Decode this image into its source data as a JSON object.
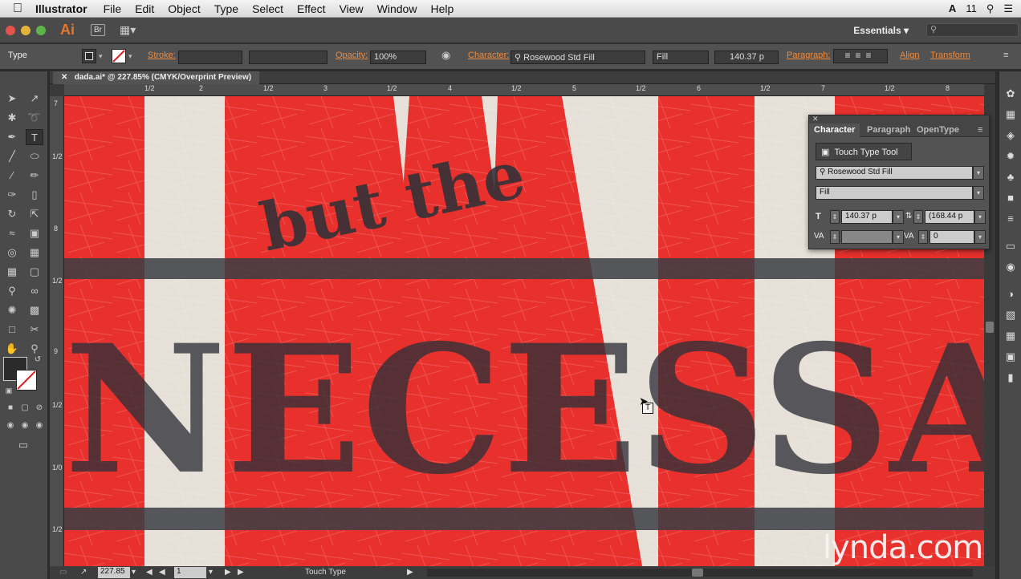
{
  "menubar": {
    "app_name": "Illustrator",
    "items": [
      "File",
      "Edit",
      "Object",
      "Type",
      "Select",
      "Effect",
      "View",
      "Window",
      "Help"
    ],
    "status_num": "11"
  },
  "appbar": {
    "app_logo": "Ai",
    "bridge_label": "Br",
    "workspace": "Essentials"
  },
  "control_bar": {
    "tool_label": "Type",
    "stroke_label": "Stroke:",
    "opacity_label": "Opacity:",
    "opacity_value": "100%",
    "character_label": "Character:",
    "font_family": "Rosewood Std Fill",
    "font_style": "Fill",
    "font_size": "140.37 p",
    "paragraph_label": "Paragraph:",
    "align_label": "Align",
    "transform_label": "Transform"
  },
  "document": {
    "tab_title": "dada.ai* @ 227.85% (CMYK/Overprint Preview)",
    "ruler_top": [
      "1/2",
      "2",
      "1/2",
      "3",
      "1/2",
      "4",
      "1/2",
      "5",
      "1/2",
      "6",
      "1/2",
      "7",
      "1/2",
      "8"
    ],
    "ruler_left": [
      "7",
      "1/2",
      "8",
      "1/2",
      "9",
      "1/2",
      "1/0",
      "1/2"
    ]
  },
  "artwork": {
    "line1": "but the",
    "line2": "NECESSA"
  },
  "status_bar": {
    "zoom": "227.85",
    "artboard": "1",
    "current_tool": "Touch Type"
  },
  "character_panel": {
    "tabs": [
      "Character",
      "Paragraph",
      "OpenType"
    ],
    "touch_type_button": "Touch Type Tool",
    "font_family": "Rosewood Std Fill",
    "font_style": "Fill",
    "font_size": "140.37 p",
    "leading": "(168.44 p",
    "kerning": "",
    "tracking": "0"
  },
  "watermark": "lynda.com",
  "colors": {
    "accent_orange": "#ef8a3b",
    "art_red": "#e8302c",
    "art_cream": "#e6e0d8",
    "art_ink": "#3a3d44"
  }
}
